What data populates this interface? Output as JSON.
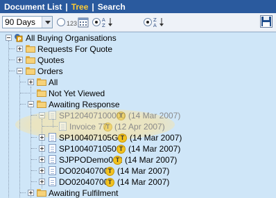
{
  "tabs": [
    {
      "label": "Document List"
    },
    {
      "label": "Tree"
    },
    {
      "label": "Search"
    }
  ],
  "toolbar": {
    "period_selected": "90 Days",
    "radio_numeric_label": "123",
    "radio_alpha_label": "az"
  },
  "tree": {
    "root": "All Buying Organisations",
    "requests_for_quote": "Requests For Quote",
    "quotes": "Quotes",
    "orders": "Orders",
    "all": "All",
    "not_yet_viewed": "Not Yet Viewed",
    "awaiting_response": "Awaiting Response",
    "items": [
      {
        "label": "SP120407100000",
        "badge": "T",
        "date": "(14 Mar 2007)"
      },
      {
        "label": "Invoice 77",
        "badge": "T",
        "date": "(12 Apr 2007)"
      },
      {
        "label": "SP100407105GHI",
        "badge": "T",
        "date": "(14 Mar 2007)"
      },
      {
        "label": "SP100407105000",
        "badge": "T",
        "date": "(14 Mar 2007)"
      },
      {
        "label": "SJPPODemo002",
        "badge": "T",
        "date": "(14 Mar 2007)"
      },
      {
        "label": "DO020407003",
        "badge": "T",
        "date": "(14 Mar 2007)"
      },
      {
        "label": "DO020407002",
        "badge": "T",
        "date": "(14 Mar 2007)"
      }
    ],
    "awaiting_fulfilment": "Awaiting Fulfilment"
  }
}
